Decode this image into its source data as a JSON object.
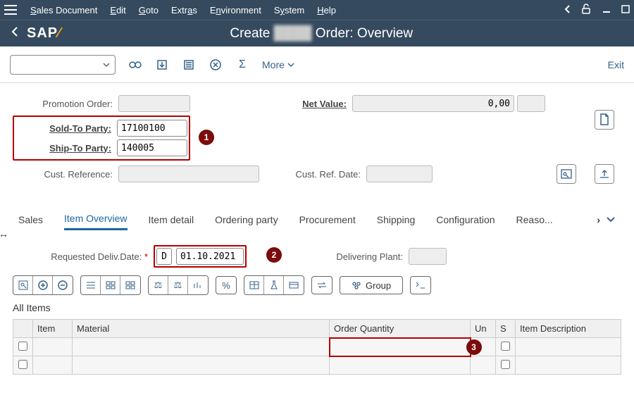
{
  "menu": {
    "items": [
      "Sales Document",
      "Edit",
      "Goto",
      "Extras",
      "Environment",
      "System",
      "Help"
    ]
  },
  "title": "Create ████ Order: Overview",
  "toolbar": {
    "more": "More",
    "exit": "Exit"
  },
  "form": {
    "promotion_label": "Promotion Order:",
    "soldto_label": "Sold-To Party:",
    "shipto_label": "Ship-To Party:",
    "custref_label": "Cust. Reference:",
    "netvalue_label": "Net Value:",
    "custrefdate_label": "Cust. Ref. Date:",
    "soldto": "17100100",
    "shipto": "140005",
    "netvalue": "0,00"
  },
  "tabs": [
    "Sales",
    "Item Overview",
    "Item detail",
    "Ordering party",
    "Procurement",
    "Shipping",
    "Configuration",
    "Reaso..."
  ],
  "active_tab": 1,
  "overview": {
    "reqdate_label": "Requested Deliv.Date:",
    "date_type": "D",
    "date": "01.10.2021",
    "delivering_plant_label": "Delivering Plant:"
  },
  "group_btn": "Group",
  "section_title": "All Items",
  "columns": [
    "",
    "Item",
    "Material",
    "Order Quantity",
    "Un",
    "S",
    "Item Description"
  ],
  "annotations": {
    "a1": "1",
    "a2": "2",
    "a3": "3"
  }
}
